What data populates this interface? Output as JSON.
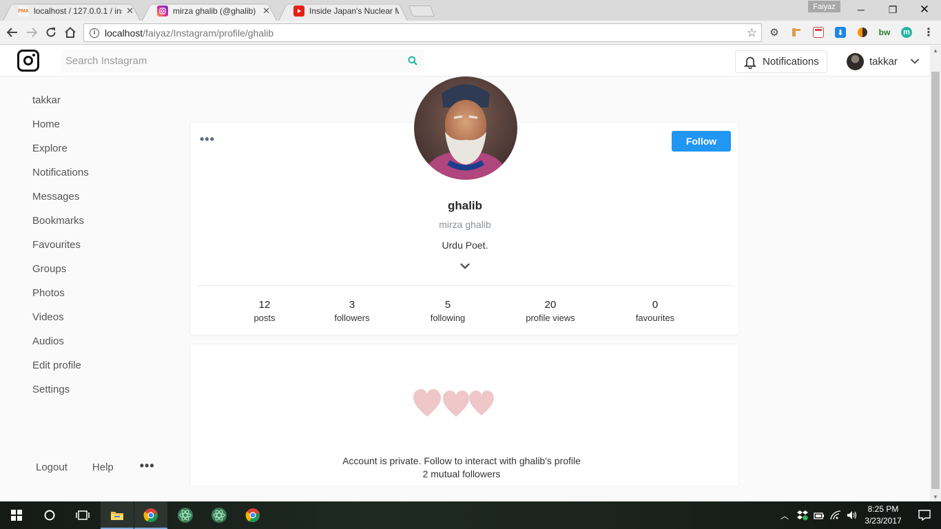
{
  "browser": {
    "tabs": [
      {
        "title": "localhost / 127.0.0.1 / ins",
        "favicon": "phpmyadmin-icon",
        "active": false
      },
      {
        "title": "mirza ghalib (@ghalib) | I",
        "favicon": "instagram-icon",
        "active": true
      },
      {
        "title": "Inside Japan's Nuclear M",
        "favicon": "youtube-icon",
        "active": false
      }
    ],
    "profile_name": "Faiyaz",
    "url_host": "localhost",
    "url_path": "/faiyaz/Instagram/profile/ghalib"
  },
  "header": {
    "search_placeholder": "Search Instagram",
    "notifications_label": "Notifications",
    "current_user": "takkar"
  },
  "sidebar": {
    "items": [
      {
        "label": "takkar"
      },
      {
        "label": "Home"
      },
      {
        "label": "Explore"
      },
      {
        "label": "Notifications"
      },
      {
        "label": "Messages"
      },
      {
        "label": "Bookmarks"
      },
      {
        "label": "Favourites"
      },
      {
        "label": "Groups"
      },
      {
        "label": "Photos"
      },
      {
        "label": "Videos"
      },
      {
        "label": "Audios"
      },
      {
        "label": "Edit profile"
      },
      {
        "label": "Settings"
      }
    ],
    "footer": {
      "logout": "Logout",
      "help": "Help",
      "more": "•••"
    }
  },
  "profile": {
    "menu_dots": "•••",
    "follow_label": "Follow",
    "username": "ghalib",
    "full_name": "mirza ghalib",
    "bio": "Urdu Poet.",
    "stats": [
      {
        "value": "12",
        "label": "posts"
      },
      {
        "value": "3",
        "label": "followers"
      },
      {
        "value": "5",
        "label": "following"
      },
      {
        "value": "20",
        "label": "profile views"
      },
      {
        "value": "0",
        "label": "favourites"
      }
    ]
  },
  "private_notice": {
    "message": "Account is private. Follow to interact with ghalib's profile",
    "mutual": "2 mutual followers"
  },
  "taskbar": {
    "time": "8:25 PM",
    "date": "3/23/2017"
  },
  "colors": {
    "accent": "#2196f3",
    "hearts": "#efc7c9"
  }
}
